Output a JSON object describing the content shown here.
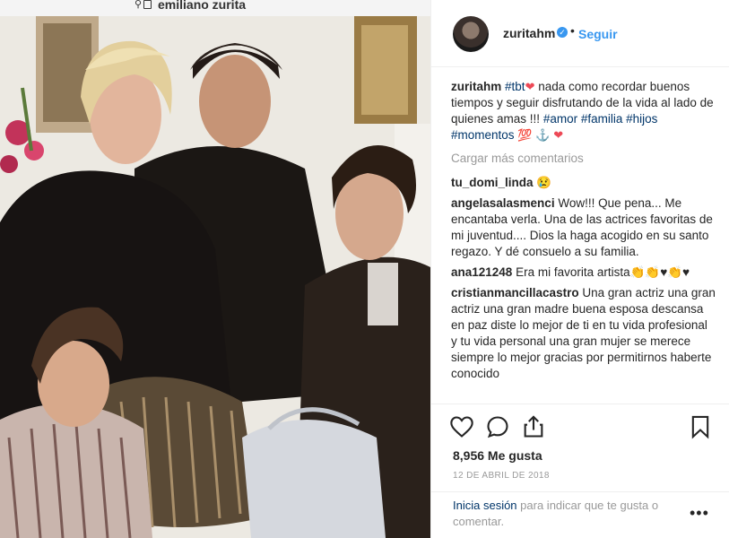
{
  "browser": {
    "address_text": "emiliano zurita"
  },
  "post": {
    "username": "zuritahm",
    "verified_badge": "✓",
    "separator": "•",
    "follow_label": "Seguir",
    "caption": {
      "user": "zuritahm",
      "tag1": "#tbt",
      "emoji1": "❤",
      "text": "nada como recordar buenos tiempos y seguir disfrutando de la vida al lado de quienes amas !!!",
      "tag2": "#amor",
      "tag3": "#familia",
      "tag4": "#hijos",
      "tag5": "#momentos",
      "emoji2": "💯",
      "emoji3": "⚓",
      "emoji4": "❤"
    },
    "load_more": "Cargar más comentarios",
    "comments": [
      {
        "user": "tu_domi_linda",
        "text": "😢"
      },
      {
        "user": "angelasalasmenci",
        "text": "Wow!!! Que pena... Me encantaba verla. Una de las actrices favoritas de mi juventud.... Dios la haga acogido en su santo regazo. Y dé consuelo a su familia."
      },
      {
        "user": "ana121248",
        "text": "Era mi favorita artista👏👏♥👏♥"
      },
      {
        "user": "cristianmancillacastro",
        "text": "Una gran actriz una gran actriz una gran madre buena esposa descansa en paz diste lo mejor de ti en tu vida profesional y tu vida personal una gran mujer se merece siempre lo mejor gracias por permitirnos haberte conocido"
      }
    ],
    "likes": "8,956 Me gusta",
    "date": "12 DE ABRIL DE 2018",
    "login_link": "Inicia sesión",
    "login_text": "para indicar que te gusta o comentar.",
    "more": "•••"
  },
  "icons": [
    "search-icon",
    "lock-icon",
    "heart-icon",
    "comment-icon",
    "share-icon",
    "bookmark-icon",
    "more-options-icon"
  ],
  "colors": {
    "link_blue": "#3897f0",
    "tag_blue": "#003569",
    "muted": "#999999",
    "heart_red": "#ed4956"
  }
}
